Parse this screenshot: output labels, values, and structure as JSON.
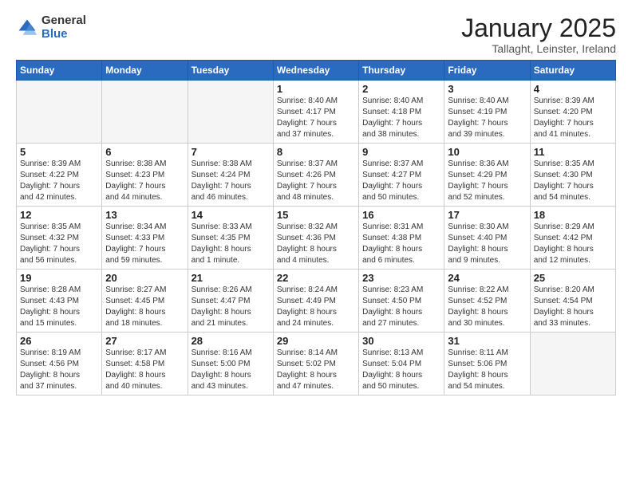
{
  "logo": {
    "general": "General",
    "blue": "Blue"
  },
  "title": "January 2025",
  "subtitle": "Tallaght, Leinster, Ireland",
  "weekdays": [
    "Sunday",
    "Monday",
    "Tuesday",
    "Wednesday",
    "Thursday",
    "Friday",
    "Saturday"
  ],
  "weeks": [
    [
      {
        "day": "",
        "detail": ""
      },
      {
        "day": "",
        "detail": ""
      },
      {
        "day": "",
        "detail": ""
      },
      {
        "day": "1",
        "detail": "Sunrise: 8:40 AM\nSunset: 4:17 PM\nDaylight: 7 hours\nand 37 minutes."
      },
      {
        "day": "2",
        "detail": "Sunrise: 8:40 AM\nSunset: 4:18 PM\nDaylight: 7 hours\nand 38 minutes."
      },
      {
        "day": "3",
        "detail": "Sunrise: 8:40 AM\nSunset: 4:19 PM\nDaylight: 7 hours\nand 39 minutes."
      },
      {
        "day": "4",
        "detail": "Sunrise: 8:39 AM\nSunset: 4:20 PM\nDaylight: 7 hours\nand 41 minutes."
      }
    ],
    [
      {
        "day": "5",
        "detail": "Sunrise: 8:39 AM\nSunset: 4:22 PM\nDaylight: 7 hours\nand 42 minutes."
      },
      {
        "day": "6",
        "detail": "Sunrise: 8:38 AM\nSunset: 4:23 PM\nDaylight: 7 hours\nand 44 minutes."
      },
      {
        "day": "7",
        "detail": "Sunrise: 8:38 AM\nSunset: 4:24 PM\nDaylight: 7 hours\nand 46 minutes."
      },
      {
        "day": "8",
        "detail": "Sunrise: 8:37 AM\nSunset: 4:26 PM\nDaylight: 7 hours\nand 48 minutes."
      },
      {
        "day": "9",
        "detail": "Sunrise: 8:37 AM\nSunset: 4:27 PM\nDaylight: 7 hours\nand 50 minutes."
      },
      {
        "day": "10",
        "detail": "Sunrise: 8:36 AM\nSunset: 4:29 PM\nDaylight: 7 hours\nand 52 minutes."
      },
      {
        "day": "11",
        "detail": "Sunrise: 8:35 AM\nSunset: 4:30 PM\nDaylight: 7 hours\nand 54 minutes."
      }
    ],
    [
      {
        "day": "12",
        "detail": "Sunrise: 8:35 AM\nSunset: 4:32 PM\nDaylight: 7 hours\nand 56 minutes."
      },
      {
        "day": "13",
        "detail": "Sunrise: 8:34 AM\nSunset: 4:33 PM\nDaylight: 7 hours\nand 59 minutes."
      },
      {
        "day": "14",
        "detail": "Sunrise: 8:33 AM\nSunset: 4:35 PM\nDaylight: 8 hours\nand 1 minute."
      },
      {
        "day": "15",
        "detail": "Sunrise: 8:32 AM\nSunset: 4:36 PM\nDaylight: 8 hours\nand 4 minutes."
      },
      {
        "day": "16",
        "detail": "Sunrise: 8:31 AM\nSunset: 4:38 PM\nDaylight: 8 hours\nand 6 minutes."
      },
      {
        "day": "17",
        "detail": "Sunrise: 8:30 AM\nSunset: 4:40 PM\nDaylight: 8 hours\nand 9 minutes."
      },
      {
        "day": "18",
        "detail": "Sunrise: 8:29 AM\nSunset: 4:42 PM\nDaylight: 8 hours\nand 12 minutes."
      }
    ],
    [
      {
        "day": "19",
        "detail": "Sunrise: 8:28 AM\nSunset: 4:43 PM\nDaylight: 8 hours\nand 15 minutes."
      },
      {
        "day": "20",
        "detail": "Sunrise: 8:27 AM\nSunset: 4:45 PM\nDaylight: 8 hours\nand 18 minutes."
      },
      {
        "day": "21",
        "detail": "Sunrise: 8:26 AM\nSunset: 4:47 PM\nDaylight: 8 hours\nand 21 minutes."
      },
      {
        "day": "22",
        "detail": "Sunrise: 8:24 AM\nSunset: 4:49 PM\nDaylight: 8 hours\nand 24 minutes."
      },
      {
        "day": "23",
        "detail": "Sunrise: 8:23 AM\nSunset: 4:50 PM\nDaylight: 8 hours\nand 27 minutes."
      },
      {
        "day": "24",
        "detail": "Sunrise: 8:22 AM\nSunset: 4:52 PM\nDaylight: 8 hours\nand 30 minutes."
      },
      {
        "day": "25",
        "detail": "Sunrise: 8:20 AM\nSunset: 4:54 PM\nDaylight: 8 hours\nand 33 minutes."
      }
    ],
    [
      {
        "day": "26",
        "detail": "Sunrise: 8:19 AM\nSunset: 4:56 PM\nDaylight: 8 hours\nand 37 minutes."
      },
      {
        "day": "27",
        "detail": "Sunrise: 8:17 AM\nSunset: 4:58 PM\nDaylight: 8 hours\nand 40 minutes."
      },
      {
        "day": "28",
        "detail": "Sunrise: 8:16 AM\nSunset: 5:00 PM\nDaylight: 8 hours\nand 43 minutes."
      },
      {
        "day": "29",
        "detail": "Sunrise: 8:14 AM\nSunset: 5:02 PM\nDaylight: 8 hours\nand 47 minutes."
      },
      {
        "day": "30",
        "detail": "Sunrise: 8:13 AM\nSunset: 5:04 PM\nDaylight: 8 hours\nand 50 minutes."
      },
      {
        "day": "31",
        "detail": "Sunrise: 8:11 AM\nSunset: 5:06 PM\nDaylight: 8 hours\nand 54 minutes."
      },
      {
        "day": "",
        "detail": ""
      }
    ]
  ]
}
